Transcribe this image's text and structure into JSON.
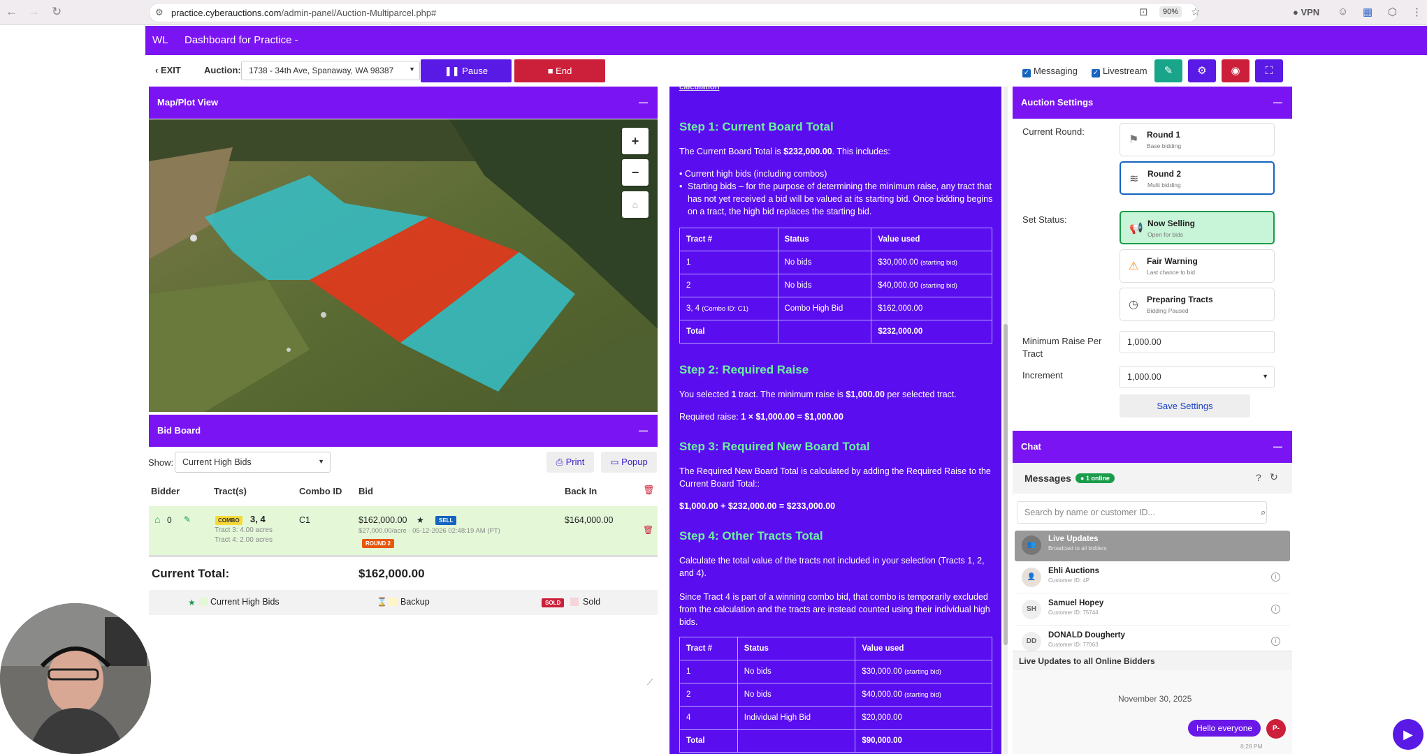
{
  "browser": {
    "url_host": "practice.cyberauctions.com",
    "url_path": "/admin-panel/Auction-Multiparcel.php#",
    "zoom": "90%",
    "vpn": "VPN"
  },
  "appbar": {
    "initials": "WL",
    "title": "Dashboard for Practice -"
  },
  "toolbar": {
    "exit": "EXIT",
    "auction_label": "Auction:",
    "auction_value": "1738 - 34th Ave, Spanaway, WA 98387",
    "pause": "Pause",
    "end": "End",
    "messaging": "Messaging",
    "livestream": "Livestream"
  },
  "map": {
    "title": "Map/Plot View",
    "zoom_in": "+",
    "zoom_out": "−",
    "home": "⌂"
  },
  "bidboard": {
    "title": "Bid Board",
    "show_label": "Show:",
    "show_value": "Current High Bids",
    "print": "Print",
    "popup": "Popup",
    "headers": [
      "Bidder",
      "Tract(s)",
      "Combo ID",
      "Bid",
      "Back In"
    ],
    "row": {
      "bidder": "0",
      "combo_badge": "COMBO",
      "tracts": "3, 4",
      "tract3": "Tract 3: 4.00 acres",
      "tract4": "Tract 4: 2.00 acres",
      "combo_id": "C1",
      "bid": "$162,000.00",
      "sell": "SELL",
      "bid_detail": "$27,000.00/acre · 05-12-2026 02:48:19 AM (PT)",
      "round": "ROUND 2",
      "back_in": "$164,000.00"
    },
    "total_label": "Current Total:",
    "total_value": "$162,000.00",
    "legend": {
      "high": "Current High Bids",
      "backup": "Backup",
      "sold_badge": "SOLD",
      "sold": "Sold"
    }
  },
  "explain": {
    "cut_top": "calculation",
    "step1": "Step 1: Current Board Total",
    "s1_intro_a": "The Current Board Total is ",
    "s1_intro_b": "$232,000.00",
    "s1_intro_c": ". This includes:",
    "s1_b1": "Current high bids (including combos)",
    "s1_b2": "Starting bids – for the purpose of determining the minimum raise, any tract that has not yet received a bid will be valued at its starting bid. Once bidding begins on a tract, the high bid replaces the starting bid.",
    "t1_headers": [
      "Tract #",
      "Status",
      "Value used"
    ],
    "t1_rows": [
      [
        "1",
        "No bids",
        "$30,000.00",
        "(starting bid)"
      ],
      [
        "2",
        "No bids",
        "$40,000.00",
        "(starting bid)"
      ],
      [
        "3, 4",
        "Combo High Bid",
        "$162,000.00",
        ""
      ]
    ],
    "t1_combo_note": "(Combo ID: C1)",
    "t1_total": "Total",
    "t1_total_val": "$232,000.00",
    "step2": "Step 2: Required Raise",
    "s2_a": "You selected ",
    "s2_b": "1",
    "s2_c": " tract. The minimum raise is ",
    "s2_d": "$1,000.00",
    "s2_e": " per selected tract.",
    "s2_req_a": "Required raise: ",
    "s2_req_b": "1 × $1,000.00 = $1,000.00",
    "step3": "Step 3: Required New Board Total",
    "s3_text": "The Required New Board Total is calculated by adding the Required Raise to the Current Board Total::",
    "s3_eq": "$1,000.00 + $232,000.00 = $233,000.00",
    "step4": "Step 4: Other Tracts Total",
    "s4_text": "Calculate the total value of the tracts not included in your selection (Tracts 1, 2, and 4).",
    "s4_text2": "Since Tract 4 is part of a winning combo bid, that combo is temporarily excluded from the calculation and the tracts are instead counted using their individual high bids.",
    "t2_rows": [
      [
        "1",
        "No bids",
        "$30,000.00",
        "(starting bid)"
      ],
      [
        "2",
        "No bids",
        "$40,000.00",
        "(starting bid)"
      ],
      [
        "4",
        "Individual High Bid",
        "$20,000.00",
        ""
      ]
    ],
    "t2_total": "Total",
    "t2_total_val": "$90,000.00"
  },
  "settings": {
    "title": "Auction Settings",
    "current_round": "Current Round:",
    "round1": "Round 1",
    "round1_sub": "Base bidding",
    "round2": "Round 2",
    "round2_sub": "Multi bidding",
    "set_status": "Set Status:",
    "now_selling": "Now Selling",
    "now_selling_sub": "Open for bids",
    "fair_warning": "Fair Warning",
    "fair_warning_sub": "Last chance to bid",
    "preparing": "Preparing Tracts",
    "preparing_sub": "Bidding Paused",
    "min_raise_label": "Minimum Raise Per Tract",
    "min_raise": "1,000.00",
    "increment_label": "Increment",
    "increment": "1,000.00",
    "save": "Save Settings"
  },
  "chat": {
    "title": "Chat",
    "messages": "Messages",
    "online": "1 online",
    "search_placeholder": "Search by name or customer ID...",
    "live_updates": "Live Updates",
    "live_updates_sub": "Broadcast to all bidders",
    "users": [
      {
        "name": "Ehli Auctions",
        "sub": "Customer ID: 4P",
        "initials": ""
      },
      {
        "name": "Samuel Hopey",
        "sub": "Customer ID: 75744",
        "initials": "SH"
      },
      {
        "name": "DONALD Dougherty",
        "sub": "Customer ID: 77063",
        "initials": "DD"
      }
    ],
    "live_to_all": "Live Updates to all Online Bidders",
    "date": "November 30, 2025",
    "bubble": "Hello everyone",
    "bubble_avatar": "P-",
    "bubble_time": "8:28 PM"
  }
}
